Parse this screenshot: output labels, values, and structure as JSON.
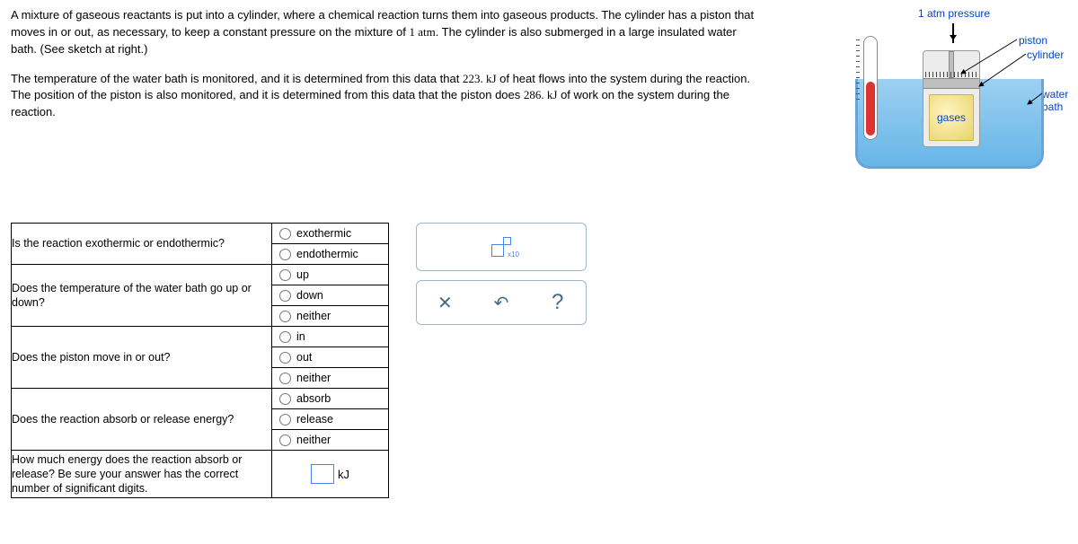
{
  "prompt": {
    "p1a": "A mixture of gaseous reactants is put into a cylinder, where a chemical reaction turns them into gaseous products. The cylinder has a piston that moves in or out, as necessary, to keep a constant pressure on the mixture of ",
    "p1_num": "1 atm",
    "p1b": ". The cylinder is also submerged in a large insulated water bath. (See sketch at right.)",
    "p2a": "The temperature of the water bath is monitored, and it is determined from this data that ",
    "p2_num1": "223. kJ",
    "p2b": " of heat flows into the system during the reaction. The position of the piston is also monitored, and it is determined from this data that the piston does ",
    "p2_num2": "286. kJ",
    "p2c": " of work on the system during the reaction."
  },
  "sketch": {
    "pressure": "1 atm pressure",
    "piston": "piston",
    "cylinder": "cylinder",
    "waterbath": "water bath",
    "gases": "gases"
  },
  "questions": {
    "q1": "Is the reaction exothermic or endothermic?",
    "q1o1": "exothermic",
    "q1o2": "endothermic",
    "q2": "Does the temperature of the water bath go up or down?",
    "q2o1": "up",
    "q2o2": "down",
    "q2o3": "neither",
    "q3": "Does the piston move in or out?",
    "q3o1": "in",
    "q3o2": "out",
    "q3o3": "neither",
    "q4": "Does the reaction absorb or release energy?",
    "q4o1": "absorb",
    "q4o2": "release",
    "q4o3": "neither",
    "q5": "How much energy does the reaction absorb or release? Be sure your answer has the correct number of significant digits.",
    "q5unit": "kJ"
  },
  "tools": {
    "x10": "x10",
    "clear": "✕",
    "undo": "↶",
    "help": "?"
  }
}
